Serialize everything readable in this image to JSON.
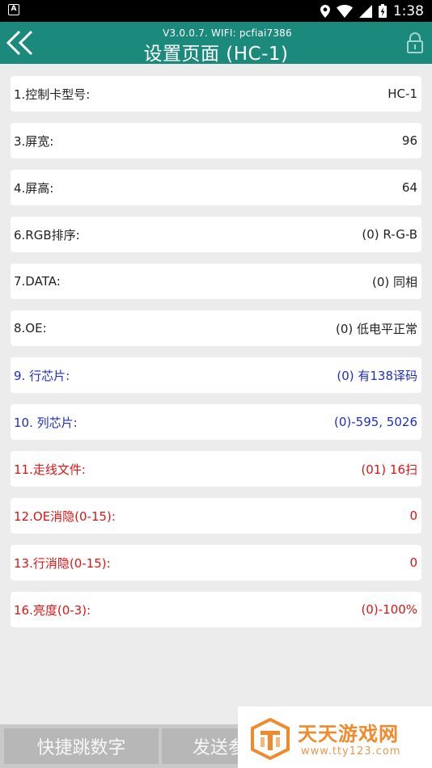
{
  "status_bar": {
    "time": "1:38",
    "icons": [
      "app-notification-icon",
      "location-icon",
      "wifi-icon",
      "signal-icon",
      "battery-icon"
    ]
  },
  "header": {
    "version_text": "V3.0.0.7.   WIFI: pcfiai7386",
    "title": "设置页面 (HC-1)",
    "back_icon": "double-chevron-left-icon",
    "lock_icon": "lock-icon",
    "background": "#1b8a7c"
  },
  "settings": [
    {
      "label": "1.控制卡型号:",
      "value": "HC-1",
      "color": "black"
    },
    {
      "label": "3.屏宽:",
      "value": "96",
      "color": "black"
    },
    {
      "label": "4.屏高:",
      "value": "64",
      "color": "black"
    },
    {
      "label": "6.RGB排序:",
      "value": "(0) R-G-B",
      "color": "black"
    },
    {
      "label": "7.DATA:",
      "value": "(0) 同相",
      "color": "black"
    },
    {
      "label": "8.OE:",
      "value": "(0) 低电平正常",
      "color": "black"
    },
    {
      "label": "9. 行芯片:",
      "value": "(0) 有138译码",
      "color": "blue"
    },
    {
      "label": "10. 列芯片:",
      "value": "(0)-595, 5026",
      "color": "blue"
    },
    {
      "label": "11.走线文件:",
      "value": "(01) 16扫",
      "color": "red"
    },
    {
      "label": "12.OE消隐(0-15):",
      "value": "0",
      "color": "red"
    },
    {
      "label": "13.行消隐(0-15):",
      "value": "0",
      "color": "red"
    },
    {
      "label": "16.亮度(0-3):",
      "value": "(0)-100%",
      "color": "red"
    }
  ],
  "bottom_bar": {
    "quick_jump_label": "快捷跳数字",
    "send_label": "发送参"
  },
  "watermark": {
    "text_cn": "天天游戏网",
    "text_url": "www.tty123.com"
  },
  "colors": {
    "black": "#222222",
    "blue": "#1f2fc8",
    "red": "#e01414"
  }
}
